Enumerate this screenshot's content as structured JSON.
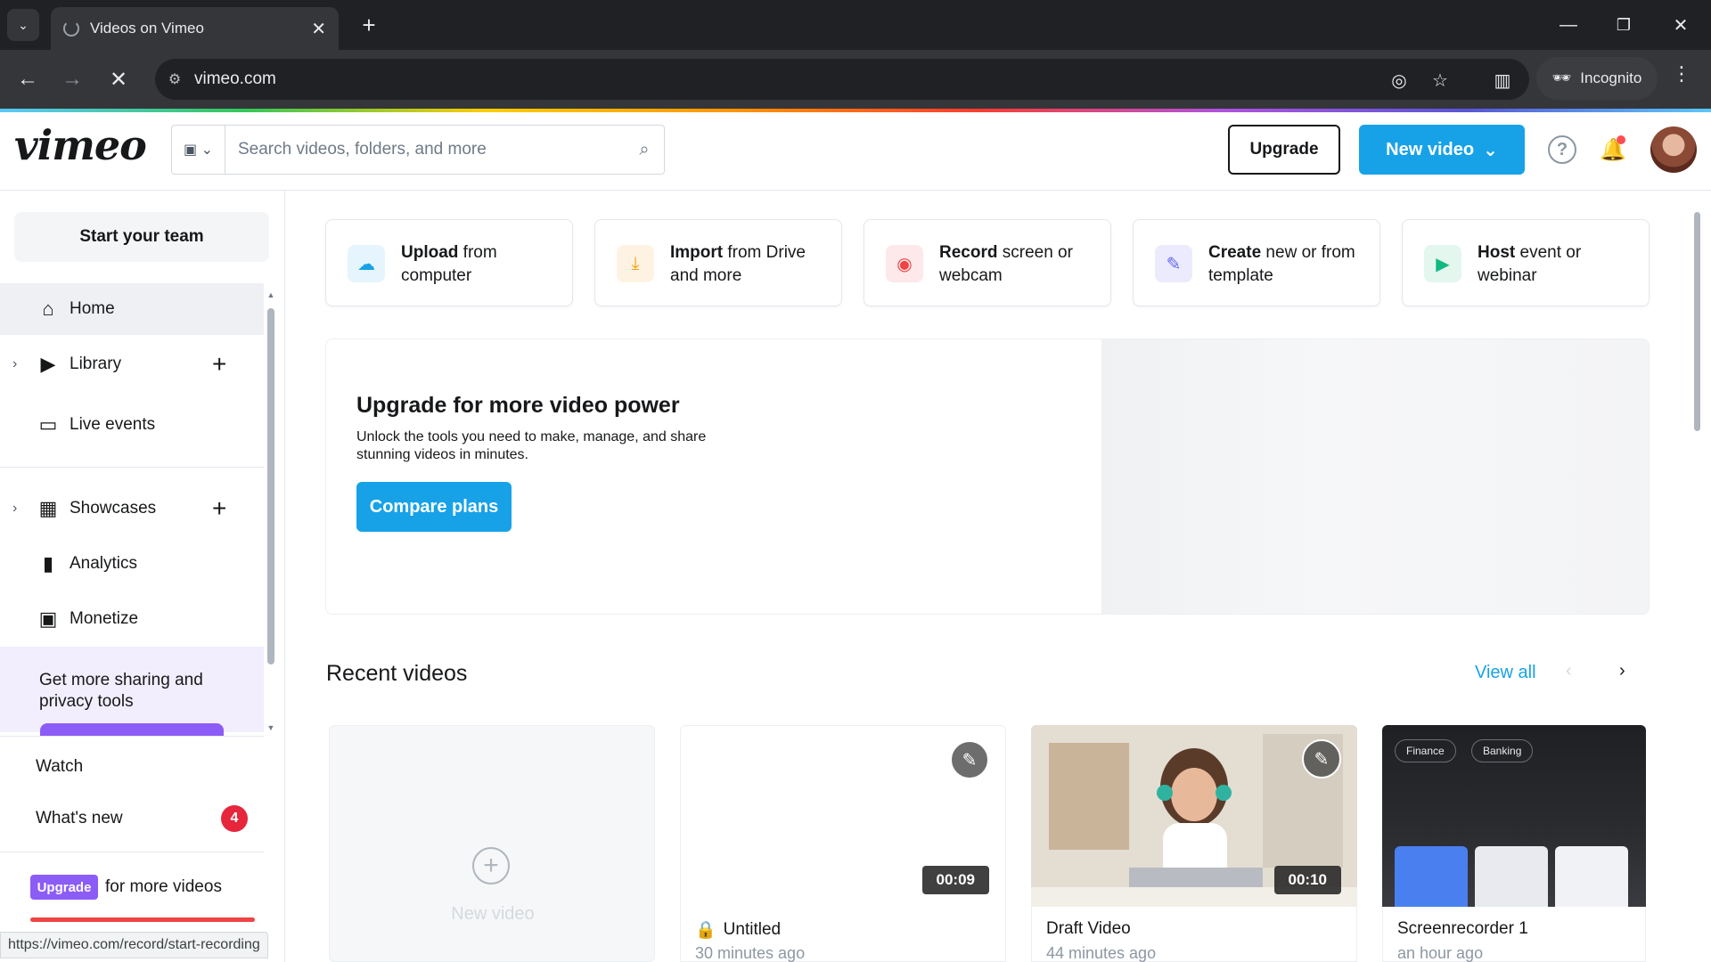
{
  "browser": {
    "tab_title": "Videos on Vimeo",
    "url": "vimeo.com",
    "profile_label": "Incognito",
    "status_url": "https://vimeo.com/record/start-recording"
  },
  "header": {
    "logo": "vimeo",
    "search_placeholder": "Search videos, folders, and more",
    "upgrade_label": "Upgrade",
    "new_video_label": "New video",
    "accent_color": "#17a2e8"
  },
  "sidebar": {
    "start_team": "Start your team",
    "items": [
      {
        "label": "Home",
        "icon": "home-icon"
      },
      {
        "label": "Library",
        "icon": "library-icon"
      },
      {
        "label": "Live events",
        "icon": "camera-icon"
      },
      {
        "label": "Showcases",
        "icon": "showcase-icon"
      },
      {
        "label": "Analytics",
        "icon": "bar-chart-icon"
      },
      {
        "label": "Monetize",
        "icon": "monetize-icon"
      }
    ],
    "promo_text": "Get more sharing and privacy tools",
    "watch": "Watch",
    "whats_new": "What's new",
    "whats_new_count": "4",
    "upgrade_chip": "Upgrade",
    "upgrade_text": "for more videos"
  },
  "actions": [
    {
      "bold": "Upload",
      "rest": " from computer",
      "icon": "upload-cloud-icon",
      "color": "#17a2e8",
      "bg": "#e6f5fd"
    },
    {
      "bold": "Import",
      "rest": " from Drive and more",
      "icon": "download-icon",
      "color": "#f59e0b",
      "bg": "#fef3e2"
    },
    {
      "bold": "Record",
      "rest": " screen or webcam",
      "icon": "record-icon",
      "color": "#ef4444",
      "bg": "#fde8ea"
    },
    {
      "bold": "Create",
      "rest": " new or from template",
      "icon": "create-icon",
      "color": "#6366f1",
      "bg": "#ecebfd"
    },
    {
      "bold": "Host",
      "rest": " event or webinar",
      "icon": "camera-icon",
      "color": "#10b981",
      "bg": "#e3f7ef"
    }
  ],
  "upgrade_panel": {
    "title": "Upgrade for more video power",
    "description": "Unlock the tools you need to make, manage, and share stunning videos in minutes.",
    "button": "Compare plans"
  },
  "recent": {
    "title": "Recent videos",
    "view_all": "View all",
    "new_video_label": "New video",
    "videos": [
      {
        "title": "Untitled",
        "time": "30 minutes ago",
        "duration": "00:09",
        "private": true
      },
      {
        "title": "Draft Video",
        "time": "44 minutes ago",
        "duration": "00:10",
        "private": false
      },
      {
        "title": "Screenrecorder 1",
        "time": "an hour ago",
        "duration": "",
        "private": false
      }
    ],
    "screenrecorder_thumb_labels": [
      "Finance",
      "Banking"
    ]
  }
}
